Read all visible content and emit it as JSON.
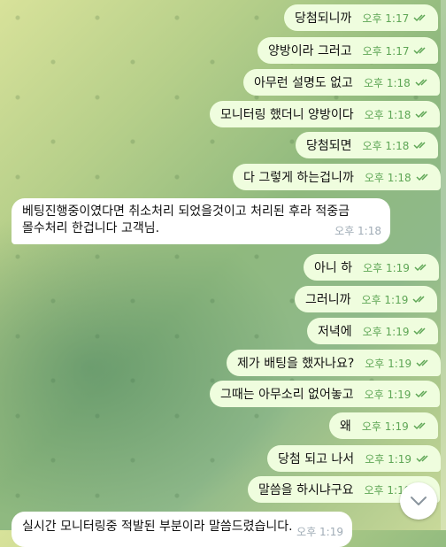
{
  "chat": {
    "outgoing": [
      {
        "text": "당첨되니까",
        "time": "오후 1:17"
      },
      {
        "text": "양방이라 그러고",
        "time": "오후 1:17"
      },
      {
        "text": "아무런 설명도 없고",
        "time": "오후 1:18"
      },
      {
        "text": "모니터링 했더니 양방이다",
        "time": "오후 1:18"
      },
      {
        "text": "당첨되면",
        "time": "오후 1:18"
      },
      {
        "text": "다 그렇게 하는겁니까",
        "time": "오후 1:18"
      },
      {
        "text": "아니 하",
        "time": "오후 1:19"
      },
      {
        "text": "그러니까",
        "time": "오후 1:19"
      },
      {
        "text": "저녁에",
        "time": "오후 1:19"
      },
      {
        "text": "제가 배팅을 했자나요?",
        "time": "오후 1:19"
      },
      {
        "text": "그때는 아무소리 없어놓고",
        "time": "오후 1:19"
      },
      {
        "text": "왜",
        "time": "오후 1:19"
      },
      {
        "text": "당첨 되고 나서",
        "time": "오후 1:19"
      },
      {
        "text": "말씀을 하시냐구요",
        "time": "오후 1:19"
      }
    ],
    "incoming": {
      "line1": "베팅진행중이였다면 취소처리 되었을것이고 처리된 후라 적중금",
      "line2": "몰수처리 한겁니다 고객님.",
      "time": "오후 1:18"
    },
    "incoming_bottom": {
      "text": "실시간 모니터링중 적발된 부분이라 말씀드렸습니다.",
      "time": "오후 1:19"
    }
  },
  "colors": {
    "outgoing_bubble": "#effdde",
    "incoming_bubble": "#ffffff",
    "tick_color": "#5ea655"
  },
  "icons": {
    "read_receipt": "double-check-icon",
    "scroll_down": "chevron-down-icon"
  }
}
